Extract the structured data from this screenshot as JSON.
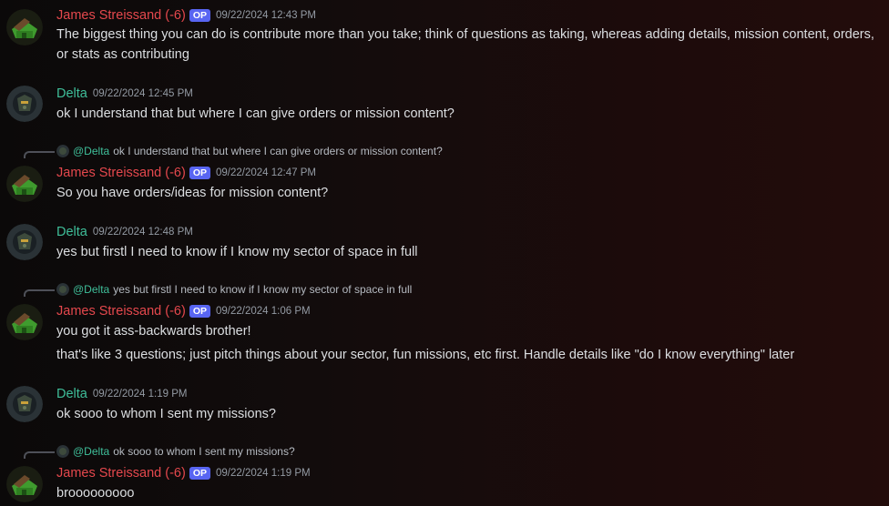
{
  "users": {
    "james": {
      "name": "James Streissand (-6)",
      "badge": "OP"
    },
    "delta": {
      "name": "Delta"
    }
  },
  "colors": {
    "james": "#e5484d",
    "delta": "#3fbf9a",
    "op_badge": "#5865f2",
    "timestamp": "#949ba4"
  },
  "messages": [
    {
      "author": "James Streissand (-6)",
      "badge": "OP",
      "timestamp": "09/22/2024 12:43 PM",
      "lines": [
        "The biggest thing you can do is contribute more than you take; think of questions as taking, whereas adding details, mission content, orders, or stats as contributing"
      ]
    },
    {
      "author": "Delta",
      "timestamp": "09/22/2024 12:45 PM",
      "lines": [
        "ok I understand that but where I can give orders or mission content?"
      ]
    },
    {
      "reply": {
        "mention": "@Delta",
        "text": "ok I understand that but where I can give orders or mission content?"
      },
      "author": "James Streissand (-6)",
      "badge": "OP",
      "timestamp": "09/22/2024 12:47 PM",
      "lines": [
        "So you have orders/ideas for mission content?"
      ]
    },
    {
      "author": "Delta",
      "timestamp": "09/22/2024 12:48 PM",
      "lines": [
        "yes but firstl I need to know if I know my sector of space in full"
      ]
    },
    {
      "reply": {
        "mention": "@Delta",
        "text": "yes but firstl I need to know if I know my sector of space in full"
      },
      "author": "James Streissand (-6)",
      "badge": "OP",
      "timestamp": "09/22/2024 1:06 PM",
      "lines": [
        "you got it ass-backwards brother!",
        "that's like 3 questions; just pitch things about your sector, fun missions, etc first. Handle details like \"do I know everything\" later"
      ]
    },
    {
      "author": "Delta",
      "timestamp": "09/22/2024 1:19 PM",
      "lines": [
        "ok sooo to whom I sent my missions?"
      ]
    },
    {
      "reply": {
        "mention": "@Delta",
        "text": "ok sooo to whom I sent my missions?"
      },
      "author": "James Streissand (-6)",
      "badge": "OP",
      "timestamp": "09/22/2024 1:19 PM",
      "lines": [
        "brooooooooo"
      ]
    }
  ]
}
